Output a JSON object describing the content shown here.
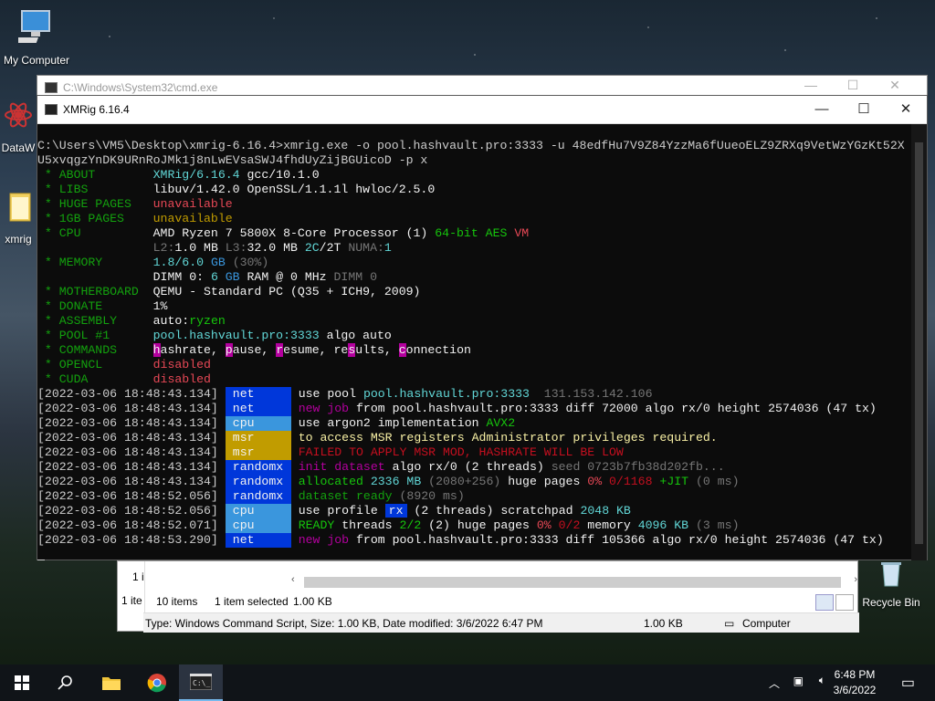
{
  "desktop": {
    "icons": [
      {
        "label": "My Computer"
      },
      {
        "label": "DataW"
      },
      {
        "label": "xmrig"
      },
      {
        "label": "Recycle Bin"
      }
    ]
  },
  "back_window": {
    "title": "C:\\Windows\\System32\\cmd.exe"
  },
  "terminal": {
    "title": "XMRig 6.16.4",
    "prompt": "C:\\Users\\VM5\\Desktop\\xmrig-6.16.4>xmrig.exe -o pool.hashvault.pro:3333 -u 48edfHu7V9Z84YzzMa6fUueoELZ9ZRXq9VetWzYGzKt52X",
    "prompt2": "U5xvqgzYnDK9URnRoJMk1j8nLwEVsaSWJ4fhdUyZijBGUicoD -p x",
    "info": {
      "about_k": " * ABOUT        ",
      "about_v1": "XMRig/6.16.4",
      "about_v2": " gcc/10.1.0",
      "libs_k": " * LIBS         ",
      "libs_v": "libuv/1.42.0 OpenSSL/1.1.1l hwloc/2.5.0",
      "huge_k": " * HUGE PAGES   ",
      "huge_v": "unavailable",
      "gb_k": " * 1GB PAGES    ",
      "gb_v": "unavailable",
      "cpu_k": " * CPU          ",
      "cpu_v1": "AMD Ryzen 7 5800X 8-Core Processor (1) ",
      "cpu_v2": "64-bit AES",
      "cpu_v3": " VM",
      "cpu2_pad": "                ",
      "cpu2_l2": "L2:",
      "cpu2_l2v": "1.0 MB",
      "cpu2_l3": " L3:",
      "cpu2_l3v": "32.0 MB",
      "cpu2_c": " 2C",
      "cpu2_t": "/2T",
      "cpu2_numa": " NUMA:",
      "cpu2_numav": "1",
      "mem_k": " * MEMORY       ",
      "mem_v1": "1.8/6.0",
      "mem_v2": " GB",
      "mem_v3": " (30%)",
      "dimm_pad": "                ",
      "dimm_v1": "DIMM 0: ",
      "dimm_v2": "6",
      "dimm_v3": " GB",
      "dimm_v4": " RAM @ 0 MHz ",
      "dimm_v5": "DIMM 0",
      "mb_k": " * MOTHERBOARD  ",
      "mb_v": "QEMU - Standard PC (Q35 + ICH9, 2009)",
      "don_k": " * DONATE       ",
      "don_v": "1%",
      "asm_k": " * ASSEMBLY     ",
      "asm_v1": "auto:",
      "asm_v2": "ryzen",
      "pool_k": " * POOL #1      ",
      "pool_v1": "pool.hashvault.pro:3333",
      "pool_v2": " algo auto",
      "cmd_k": " * COMMANDS     ",
      "cmd_h": "h",
      "cmd_1": "ashrate, ",
      "cmd_p": "p",
      "cmd_2": "ause, ",
      "cmd_r": "r",
      "cmd_3": "esume, ",
      "cmd_rs": "re",
      "cmd_s": "s",
      "cmd_4": "ults, ",
      "cmd_c": "c",
      "cmd_5": "onnection",
      "ocl_k": " * OPENCL       ",
      "ocl_v": "disabled",
      "cuda_k": " * CUDA         ",
      "cuda_v": "disabled"
    },
    "log": [
      {
        "ts": "[2022-03-06 18:48:43.134]",
        "tag": "net"
      },
      {
        "ts": "[2022-03-06 18:48:43.134]",
        "tag": "net"
      },
      {
        "ts": "[2022-03-06 18:48:43.134]",
        "tag": "cpu"
      },
      {
        "ts": "[2022-03-06 18:48:43.134]",
        "tag": "msr"
      },
      {
        "ts": "[2022-03-06 18:48:43.134]",
        "tag": "msr"
      },
      {
        "ts": "[2022-03-06 18:48:43.134]",
        "tag": "randomx"
      },
      {
        "ts": "[2022-03-06 18:48:43.134]",
        "tag": "randomx"
      },
      {
        "ts": "[2022-03-06 18:48:52.056]",
        "tag": "randomx"
      },
      {
        "ts": "[2022-03-06 18:48:52.056]",
        "tag": "cpu"
      },
      {
        "ts": "[2022-03-06 18:48:52.071]",
        "tag": "cpu"
      },
      {
        "ts": "[2022-03-06 18:48:53.290]",
        "tag": "net"
      }
    ],
    "msg": {
      "l0a": "use pool ",
      "l0b": "pool.hashvault.pro:3333",
      "l0c": "  131.153.142.106",
      "l1a": "new job",
      "l1b": " from pool.hashvault.pro:3333 diff 72000 algo rx/0 height 2574036 (47 tx)",
      "l2a": "use argon2 implementation ",
      "l2b": "AVX2",
      "l3a": "to access MSR registers Administrator privileges required.",
      "l4a": "FAILED TO APPLY MSR MOD, HASHRATE WILL BE LOW",
      "l5a": "init dataset",
      "l5b": " algo rx/0 (",
      "l5c": "2",
      "l5d": " threads) ",
      "l5e": "seed 0723b7fb38d202fb...",
      "l6a": "allocated",
      "l6b": " 2336 MB",
      "l6c": " (2080+256)",
      "l6d": " huge pages ",
      "l6e": "0%",
      "l6f": " 0/1168",
      "l6g": " +JIT",
      "l6h": " (0 ms)",
      "l7a": "dataset ready",
      "l7b": " (8920 ms)",
      "l8a": "use profile ",
      "l8b": "rx",
      "l8c": " (",
      "l8d": "2",
      "l8e": " threads) scratchpad ",
      "l8f": "2048 KB",
      "l9a": "READY",
      "l9b": " threads ",
      "l9c": "2/2",
      "l9d": " (2)",
      "l9e": " huge pages ",
      "l9f": "0%",
      "l9g": " 0/2",
      "l9h": " memory ",
      "l9i": "4096 KB",
      "l9j": " (3 ms)",
      "l10a": "new job",
      "l10b": " from pool.hashvault.pro:3333 diff 105366 algo rx/0 height 2574036 (47 tx)"
    }
  },
  "explorer": {
    "left1": "1 i",
    "left2": "1 ite",
    "items": "10 items",
    "selected": "1 item selected",
    "size": "1.00 KB",
    "type_info": "Type: Windows Command Script, Size: 1.00 KB, Date modified: 3/6/2022 6:47 PM",
    "size2": "1.00 KB",
    "location": "Computer"
  },
  "taskbar": {
    "time": "6:48 PM",
    "date": "3/6/2022"
  }
}
